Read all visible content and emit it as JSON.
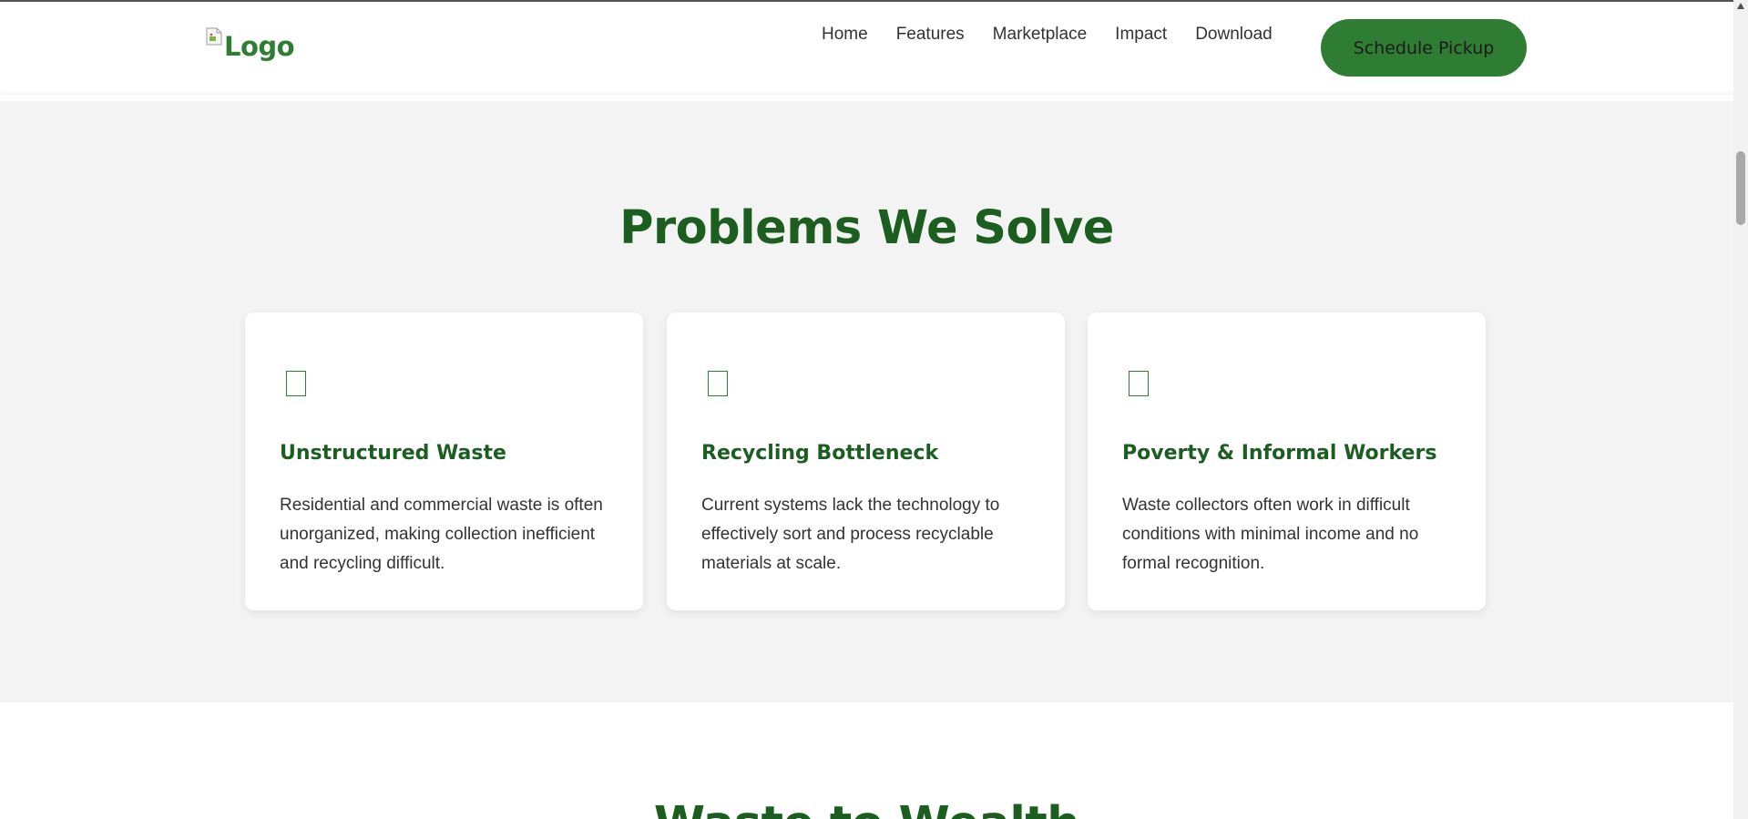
{
  "nav": {
    "logo_text": "Logo",
    "links": [
      "Home",
      "Features",
      "Marketplace",
      "Impact",
      "Download"
    ],
    "cta_label": "Schedule Pickup"
  },
  "problems": {
    "title": "Problems We Solve",
    "cards": [
      {
        "icon": "glyph-placeholder-icon",
        "title": "Unstructured Waste",
        "text": "Residential and commercial waste is often unorganized, making collection inefficient and recycling difficult."
      },
      {
        "icon": "glyph-placeholder-icon",
        "title": "Recycling Bottleneck",
        "text": "Current systems lack the technology to effectively sort and process recyclable materials at scale."
      },
      {
        "icon": "glyph-placeholder-icon",
        "title": "Poverty & Informal Workers",
        "text": "Waste collectors often work in difficult conditions with minimal income and no formal recognition."
      }
    ]
  },
  "next_section": {
    "title": "Waste to Wealth"
  },
  "colors": {
    "brand_green": "#2e7d32",
    "heading_green": "#1b5e20",
    "section_bg": "#f3f3f3"
  }
}
